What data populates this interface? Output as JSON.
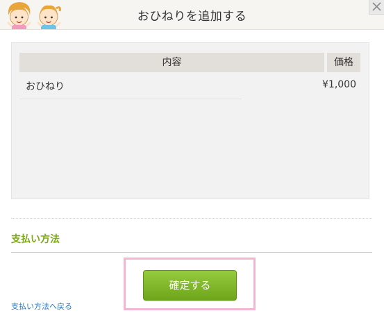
{
  "header": {
    "title": "おひねりを追加する",
    "logo_icon": "two-children-mascot-icon",
    "close_icon": "close-icon"
  },
  "table": {
    "columns": [
      "内容",
      "価格"
    ],
    "rows": [
      {
        "name": "おひねり",
        "price": "¥1,000"
      }
    ]
  },
  "payment": {
    "section_title": "支払い方法",
    "confirm_label": "確定する",
    "back_link": "支払い方法へ戻る"
  },
  "colors": {
    "accent_green": "#7cab12",
    "button_green": "#7fb62a",
    "highlight_pink": "#f3b5d2",
    "link_blue": "#2a78c2"
  }
}
